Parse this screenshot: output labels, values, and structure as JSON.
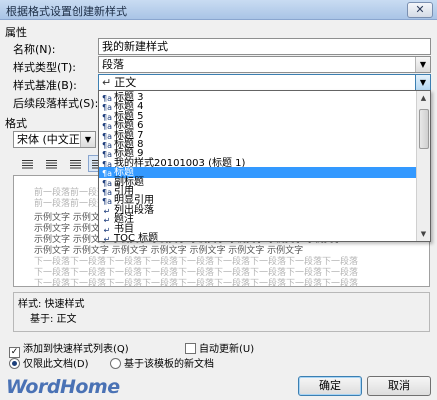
{
  "window": {
    "title": "根据格式设置创建新样式",
    "close_glyph": "✕"
  },
  "properties": {
    "section_label": "属性",
    "name_label": "名称(N):",
    "name_value": "我的新建样式",
    "type_label": "样式类型(T):",
    "type_value": "段落",
    "based_on_label": "样式基准(B):",
    "based_on_value": "正文",
    "next_label": "后续段落样式(S):"
  },
  "dropdown": {
    "items": [
      {
        "label": "标题 3",
        "icon": "linked-style-icon"
      },
      {
        "label": "标题 4",
        "icon": "linked-style-icon"
      },
      {
        "label": "标题 5",
        "icon": "linked-style-icon"
      },
      {
        "label": "标题 6",
        "icon": "linked-style-icon"
      },
      {
        "label": "标题 7",
        "icon": "linked-style-icon"
      },
      {
        "label": "标题 8",
        "icon": "linked-style-icon"
      },
      {
        "label": "标题 9",
        "icon": "linked-style-icon"
      },
      {
        "label": "我的样式20101003  (标题 1)",
        "icon": "linked-style-icon"
      },
      {
        "label": "标题",
        "icon": "linked-style-icon"
      },
      {
        "label": "副标题",
        "icon": "linked-style-icon"
      },
      {
        "label": "引用",
        "icon": "linked-style-icon"
      },
      {
        "label": "明显引用",
        "icon": "linked-style-icon"
      },
      {
        "label": "列出段落",
        "icon": "paragraph-style-icon"
      },
      {
        "label": "题注",
        "icon": "paragraph-style-icon"
      },
      {
        "label": "书目",
        "icon": "paragraph-style-icon"
      },
      {
        "label": "TOC 标题",
        "icon": "paragraph-style-icon"
      }
    ],
    "selected_index": 8
  },
  "format": {
    "section_label": "格式",
    "font_value": "宋体 (中文正文"
  },
  "preview": {
    "prev_para_1": "前一段落前一段落前一段落前一段落前一段落前一段落前一段落前一段落前一段落",
    "prev_para_2": "前一段落前一段落前一段落前一段落前一段落",
    "sample_1": "示例文字 示例文字 示例文字 示例文字 示例文字 示例文字 示例文字 示例文字",
    "sample_2": "示例文字 示例文字 示例文字 示例文字 示例文字 示例文字 示例文字 示例文字",
    "sample_3": "示例文字 示例文字 示例文字 示例文字 示例文字 示例文字 示例文字 示例文字",
    "sample_4": "示例文字 示例文字 示例文字 示例文字 示例文字 示例文字 示例文字",
    "next_para_1": "下一段落下一段落下一段落下一段落下一段落下一段落下一段落下一段落下一段落",
    "next_para_2": "下一段落下一段落下一段落下一段落下一段落下一段落下一段落下一段落下一段落",
    "next_para_3": "下一段落下一段落下一段落下一段落下一段落下一段落下一段落下一段落下一段落"
  },
  "description": {
    "line1": "样式: 快速样式",
    "line2": "基于: 正文"
  },
  "options": {
    "add_to_quick": "添加到快速样式列表(Q)",
    "auto_update": "自动更新(U)",
    "only_this_doc": "仅限此文档(D)",
    "new_docs_template": "基于该模板的新文档"
  },
  "buttons": {
    "ok": "确定",
    "cancel": "取消"
  },
  "watermark": "WordHome"
}
